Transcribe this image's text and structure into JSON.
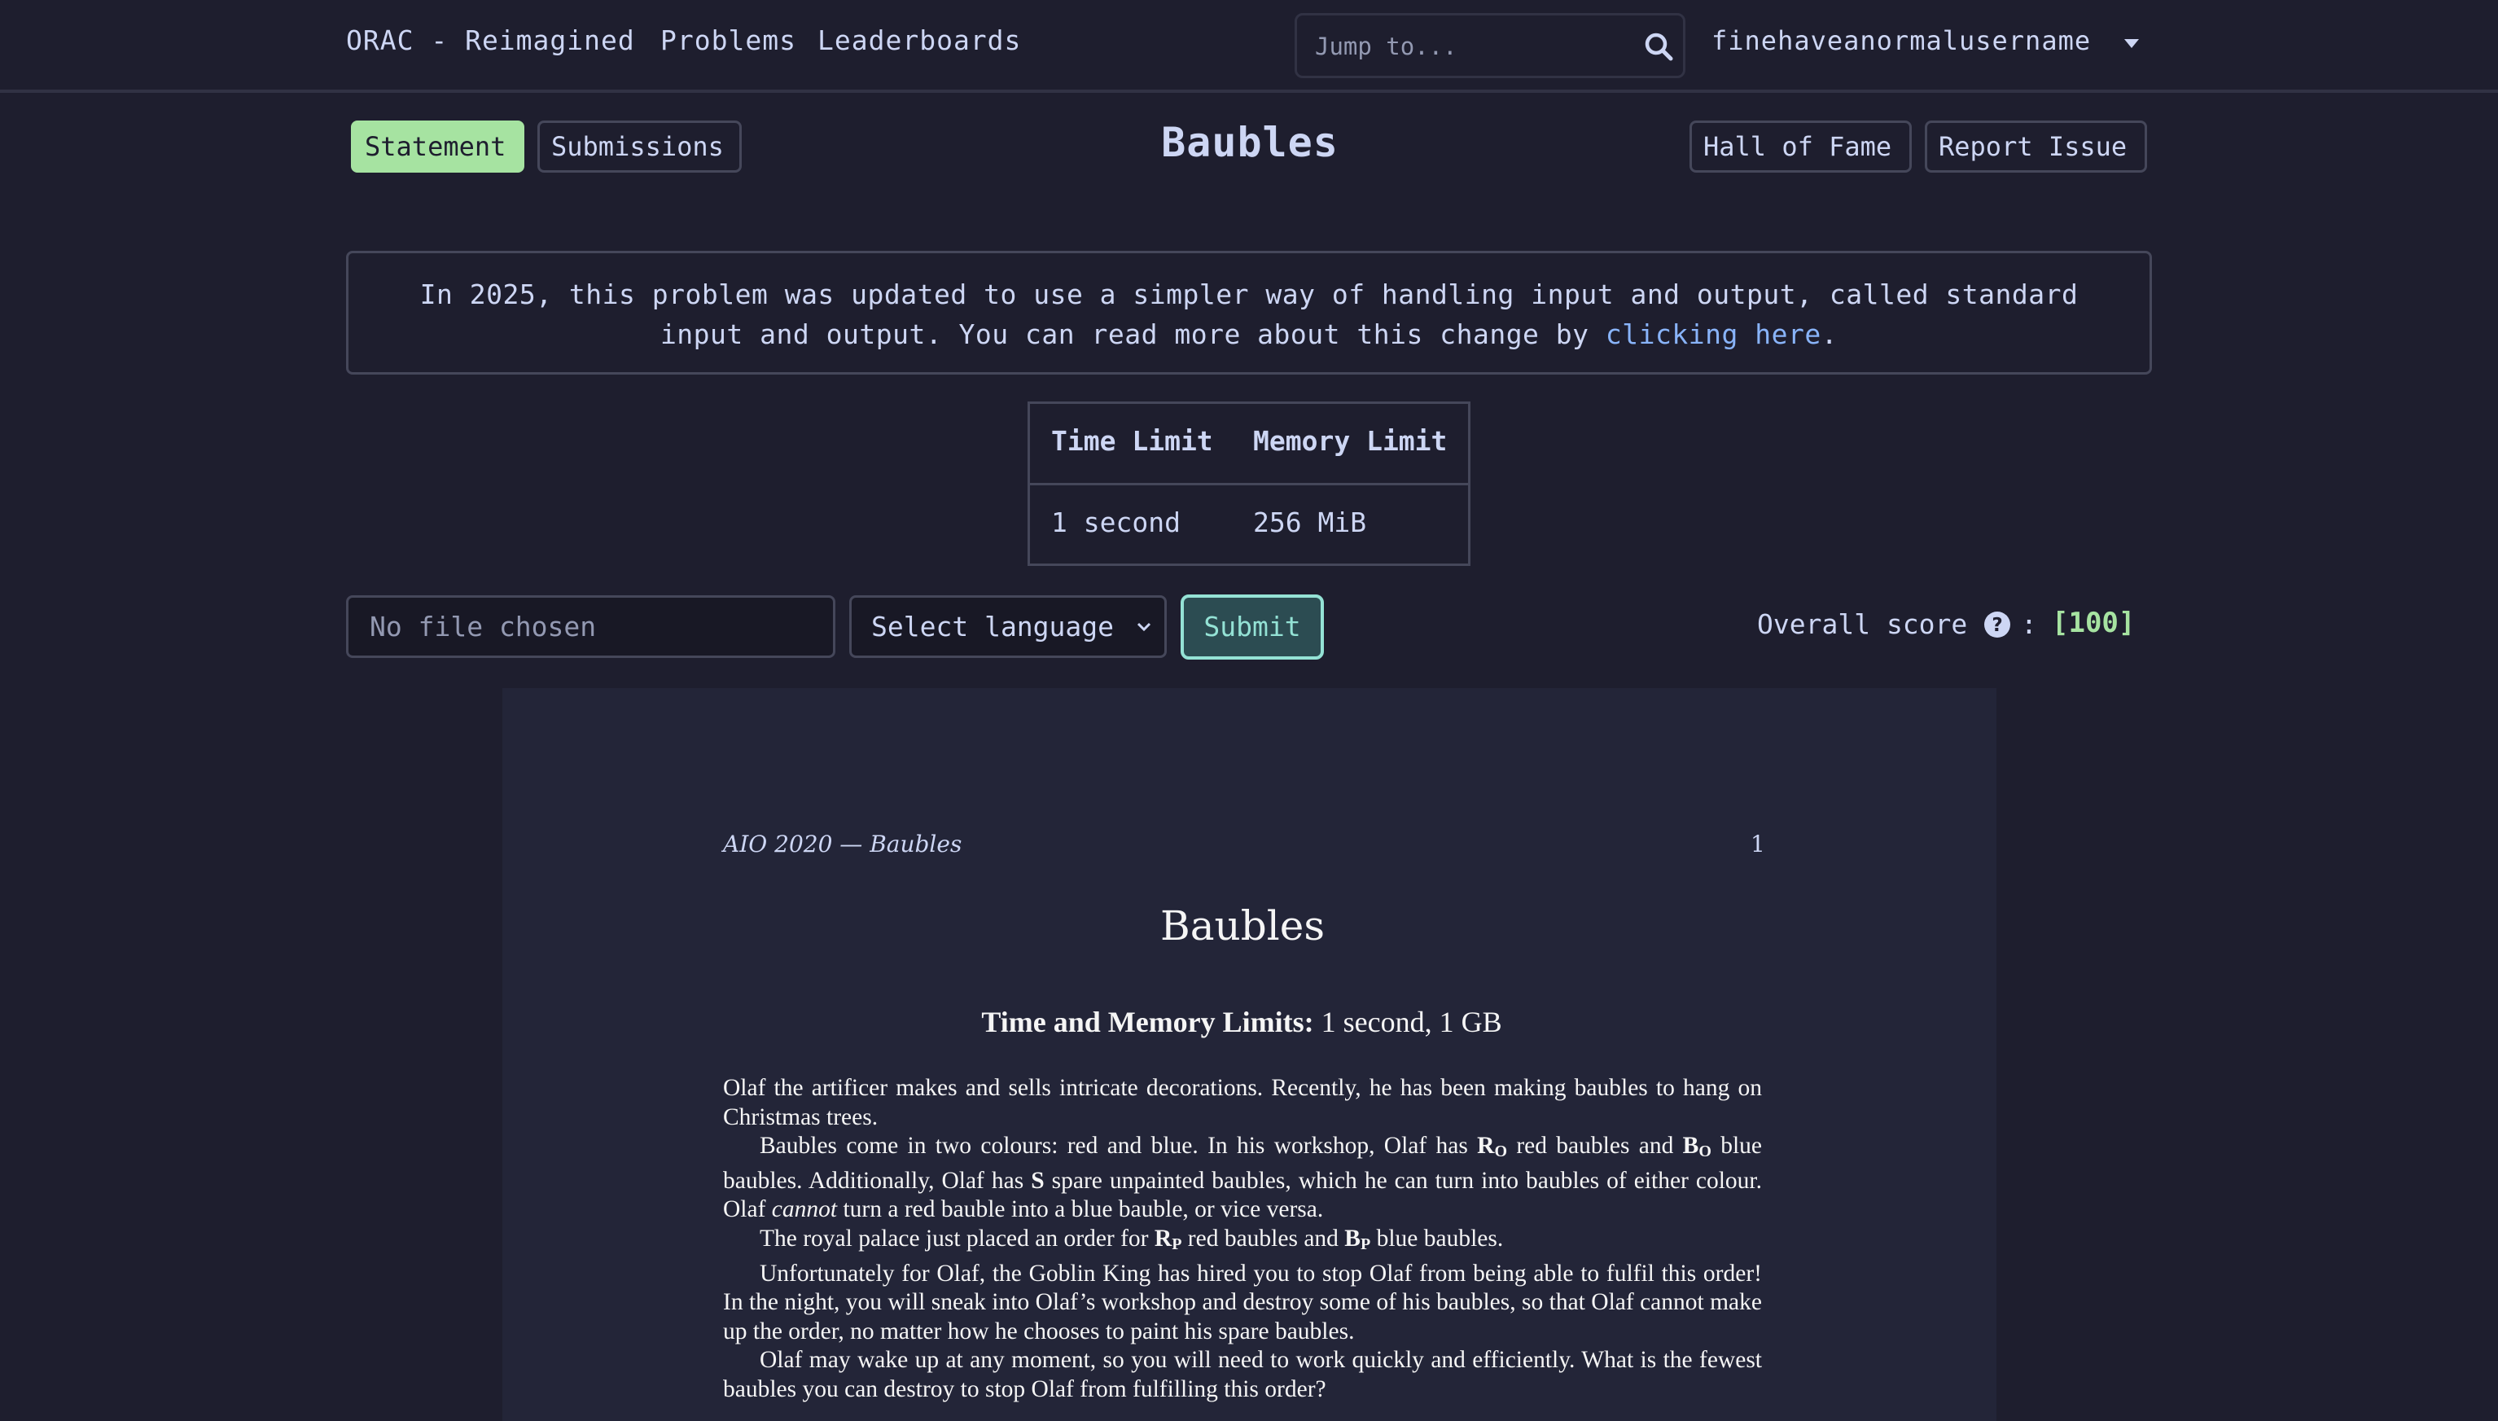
{
  "nav": {
    "brand": "ORAC - Reimagined",
    "problems": "Problems",
    "leaderboards": "Leaderboards",
    "search_placeholder": "Jump to...",
    "username": "finehaveanormalusername"
  },
  "tabs": {
    "statement": "Statement",
    "submissions": "Submissions",
    "hall_of_fame": "Hall of Fame",
    "report_issue": "Report Issue"
  },
  "problem": {
    "title": "Baubles"
  },
  "notice": {
    "text_before": "In 2025, this problem was updated to use a simpler way of handling input and output, called standard input and output. You can read more about this change by ",
    "link_text": "clicking here",
    "text_after": "."
  },
  "limits": {
    "time_header": "Time Limit",
    "memory_header": "Memory Limit",
    "time_value": "1 second",
    "memory_value": "256 MiB"
  },
  "submit_bar": {
    "file_placeholder": "No file chosen",
    "language_placeholder": "Select language",
    "submit_label": "Submit",
    "score_label": "Overall score",
    "score_colon": ":",
    "score_value": "[100]"
  },
  "document": {
    "header_left": "AIO 2020 — Baubles",
    "page_number": "1",
    "title": "Baubles",
    "limits_label": "Time and Memory Limits:",
    "limits_value": "1 second, 1 GB",
    "p1": "Olaf the artificer makes and sells intricate decorations. Recently, he has been making baubles to hang on Christmas trees.",
    "p2_a": "Baubles come in two colours: red and blue. In his workshop, Olaf has ",
    "p2_b": " red baubles and ",
    "p2_c": " blue baubles. Additionally, Olaf has ",
    "p2_d": " spare unpainted baubles, which he can turn into baubles of either colour. Olaf ",
    "p2_cannot": "cannot",
    "p2_e": " turn a red bauble into a blue bauble, or vice versa.",
    "p3_a": "The royal palace just placed an order for ",
    "p3_b": " red baubles and ",
    "p3_c": " blue baubles.",
    "p4": "Unfortunately for Olaf, the Goblin King has hired you to stop Olaf from being able to fulfil this order! In the night, you will sneak into Olaf’s workshop and destroy some of his baubles, so that Olaf cannot make up the order, no matter how he chooses to paint his spare baubles.",
    "p5": "Olaf may wake up at any moment, so you will need to work quickly and efficiently. What is the fewest baubles you can destroy to stop Olaf from fulfilling this order?",
    "var_r": "R",
    "var_b": "B",
    "var_s": "S",
    "sub_o": "O",
    "sub_p": "P"
  }
}
